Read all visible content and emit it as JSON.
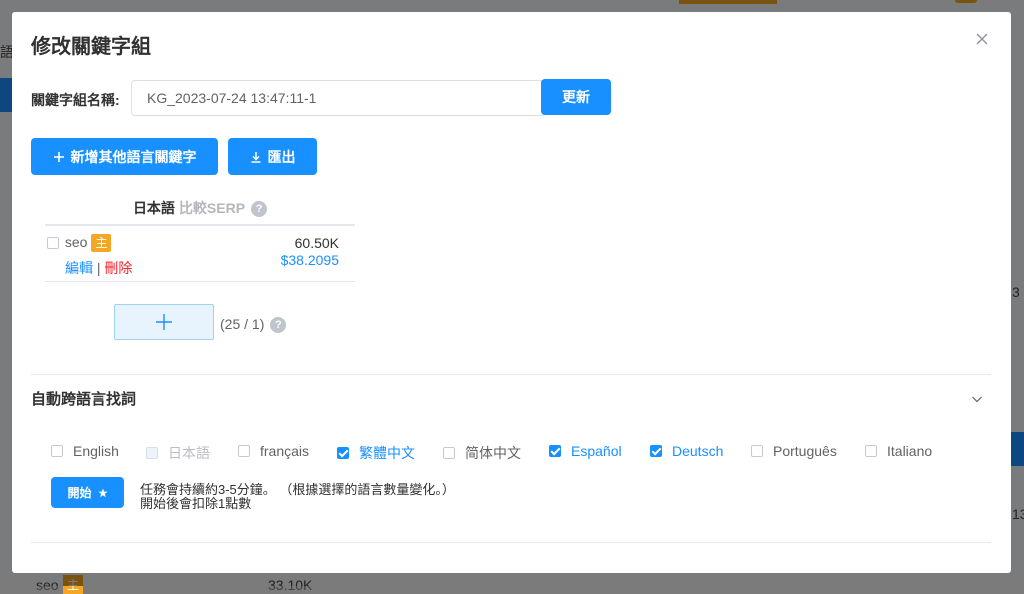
{
  "modal": {
    "title": "修改關鍵字組",
    "name_label": "關鍵字組名稱:",
    "name_value": "KG_2023-07-24 13:47:11-1",
    "update_button": "更新",
    "add_lang_button": "新增其他語言關鍵字",
    "export_button": "匯出"
  },
  "keyword_table": {
    "language": "日本語",
    "compare_serp": "比較SERP",
    "rows": [
      {
        "keyword": "seo",
        "badge": "主",
        "edit": "編輯",
        "separator": "|",
        "delete": "刪除",
        "volume": "60.50K",
        "cpc": "$38.2095"
      }
    ],
    "counter": "(25 / 1)"
  },
  "auto_find": {
    "title": "自動跨語言找詞",
    "languages": [
      {
        "label": "English",
        "checked": false,
        "disabled": false
      },
      {
        "label": "日本語",
        "checked": false,
        "disabled": true
      },
      {
        "label": "français",
        "checked": false,
        "disabled": false
      },
      {
        "label": "繁體中文",
        "checked": true,
        "disabled": false
      },
      {
        "label": "简体中文",
        "checked": false,
        "disabled": false
      },
      {
        "label": "Español",
        "checked": true,
        "disabled": false
      },
      {
        "label": "Deutsch",
        "checked": true,
        "disabled": false
      },
      {
        "label": "Português",
        "checked": false,
        "disabled": false
      },
      {
        "label": "Italiano",
        "checked": false,
        "disabled": false
      }
    ],
    "start_button": "開始",
    "note_line1": "任務會持續約3-5分鐘。 （根據選擇的語言數量變化。）",
    "note_line2": "開始後會扣除1點數"
  },
  "background": {
    "left_text": "語",
    "right_text_1": "3",
    "right_text_2": "13",
    "bottom_keyword": "seo",
    "bottom_badge": "主",
    "bottom_volume": "33.10K"
  },
  "colors": {
    "primary": "#1890ff",
    "badge": "#f5a623",
    "danger": "#f5222d"
  }
}
